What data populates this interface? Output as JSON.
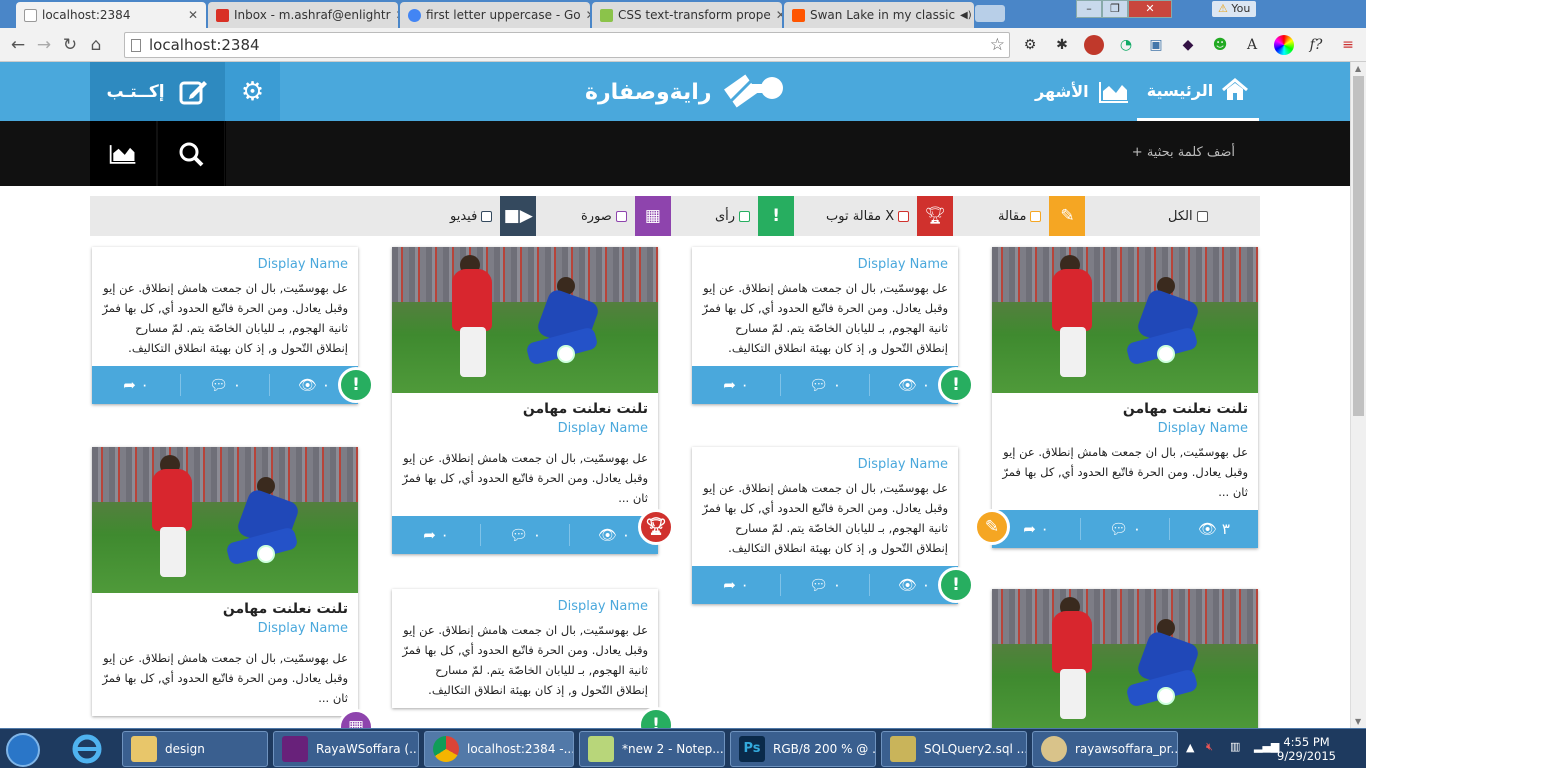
{
  "browser": {
    "tabs": [
      {
        "label": "localhost:2384",
        "color": "#e8e8e8"
      },
      {
        "label": "Inbox - m.ashraf@enlightr",
        "color": "#d93025"
      },
      {
        "label": "first letter uppercase - Go",
        "color": "#4285f4"
      },
      {
        "label": "CSS text-transform prope",
        "color": "#8bc34a"
      },
      {
        "label": "Swan Lake in my classic",
        "color": "#ff5500"
      }
    ],
    "profile": "You",
    "address": "localhost:2384"
  },
  "site": {
    "write_label": "إكــتـب",
    "logo_text": "رايةوصفارة",
    "nav_home": "الرئيسية",
    "nav_top": "الأشهر",
    "search_placeholder": "+ أضف كلمة بحثية",
    "colors": {
      "primary": "#4aa8dc",
      "dark": "#111111"
    }
  },
  "filters": [
    {
      "label": "الكل",
      "icon": "",
      "color": ""
    },
    {
      "label": "مقالة",
      "icon": "edit-icon",
      "color": "#f5a623"
    },
    {
      "label": "مقالة توب X",
      "icon": "trophy-icon",
      "color": "#d0312d"
    },
    {
      "label": "رأى",
      "icon": "exclamation-icon",
      "color": "#27ae60"
    },
    {
      "label": "صورة",
      "icon": "image-icon",
      "color": "#8e44ad"
    },
    {
      "label": "فيديو",
      "icon": "video-icon",
      "color": "#34495e"
    }
  ],
  "cards": {
    "title": "تلنت نعلنت مهامن",
    "author": "Display Name",
    "short_text": "عل بهوسمّيت, بال ان جمعت هامش إنطلاق. عن إيو وقبل يعادل. ومن الحرة فاتّبع الحدود أي, كل بها فمرّ ثان ...",
    "long_text": "عل بهوسمّيت, بال ان جمعت هامش إنطلاق. عن إيو وقبل يعادل. ومن الحرة فاتّبع الحدود أي, كل بها فمرّ ثانية الهجوم, بـ لليابان الخاصّة يتم. لمّ مسارح إنطلاق التّحول و, إذ كان بهيئة انطلاق التكاليف.",
    "views_1": "٣",
    "zero": "٠"
  },
  "taskbar": {
    "items": [
      "design",
      "RayaWSoffara (...",
      "localhost:2384 -...",
      "*new  2 - Notep...",
      "RGB/8 200 % @ ...",
      "SQLQuery2.sql ...",
      "rayawsoffara_pr..."
    ],
    "time": "4:55 PM",
    "date": "9/29/2015"
  }
}
